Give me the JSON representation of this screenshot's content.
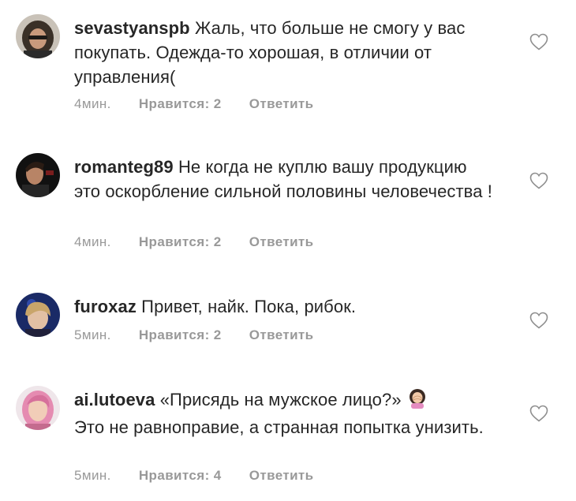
{
  "comments": [
    {
      "username": "sevastyanspb",
      "text": "Жаль, что больше не смогу у вас покупать. Одежда-то хорошая, в отличии от управления(",
      "time": "4мин.",
      "likes": "Нравится: 2",
      "reply": "Ответить"
    },
    {
      "username": "romanteg89",
      "text": "Не когда не куплю вашу продукцию это оскорбление сильной половины человечества !",
      "time": "4мин.",
      "likes": "Нравится: 2",
      "reply": "Ответить"
    },
    {
      "username": "furoxaz",
      "text": "Привет, найк. Пока, рибок.",
      "time": "5мин.",
      "likes": "Нравится: 2",
      "reply": "Ответить"
    },
    {
      "username": "ai.lutoeva",
      "text": "«Присядь на мужское лицо?»",
      "text2": "Это не равноправие, а странная попытка унизить.",
      "emoji": "woman-facepalming-emoji",
      "time": "5мин.",
      "likes": "Нравится: 4",
      "reply": "Ответить"
    }
  ],
  "icons": {
    "like": "heart-outline-icon"
  },
  "colors": {
    "text": "#262626",
    "meta": "#999999",
    "heart": "#8e8e8e"
  }
}
